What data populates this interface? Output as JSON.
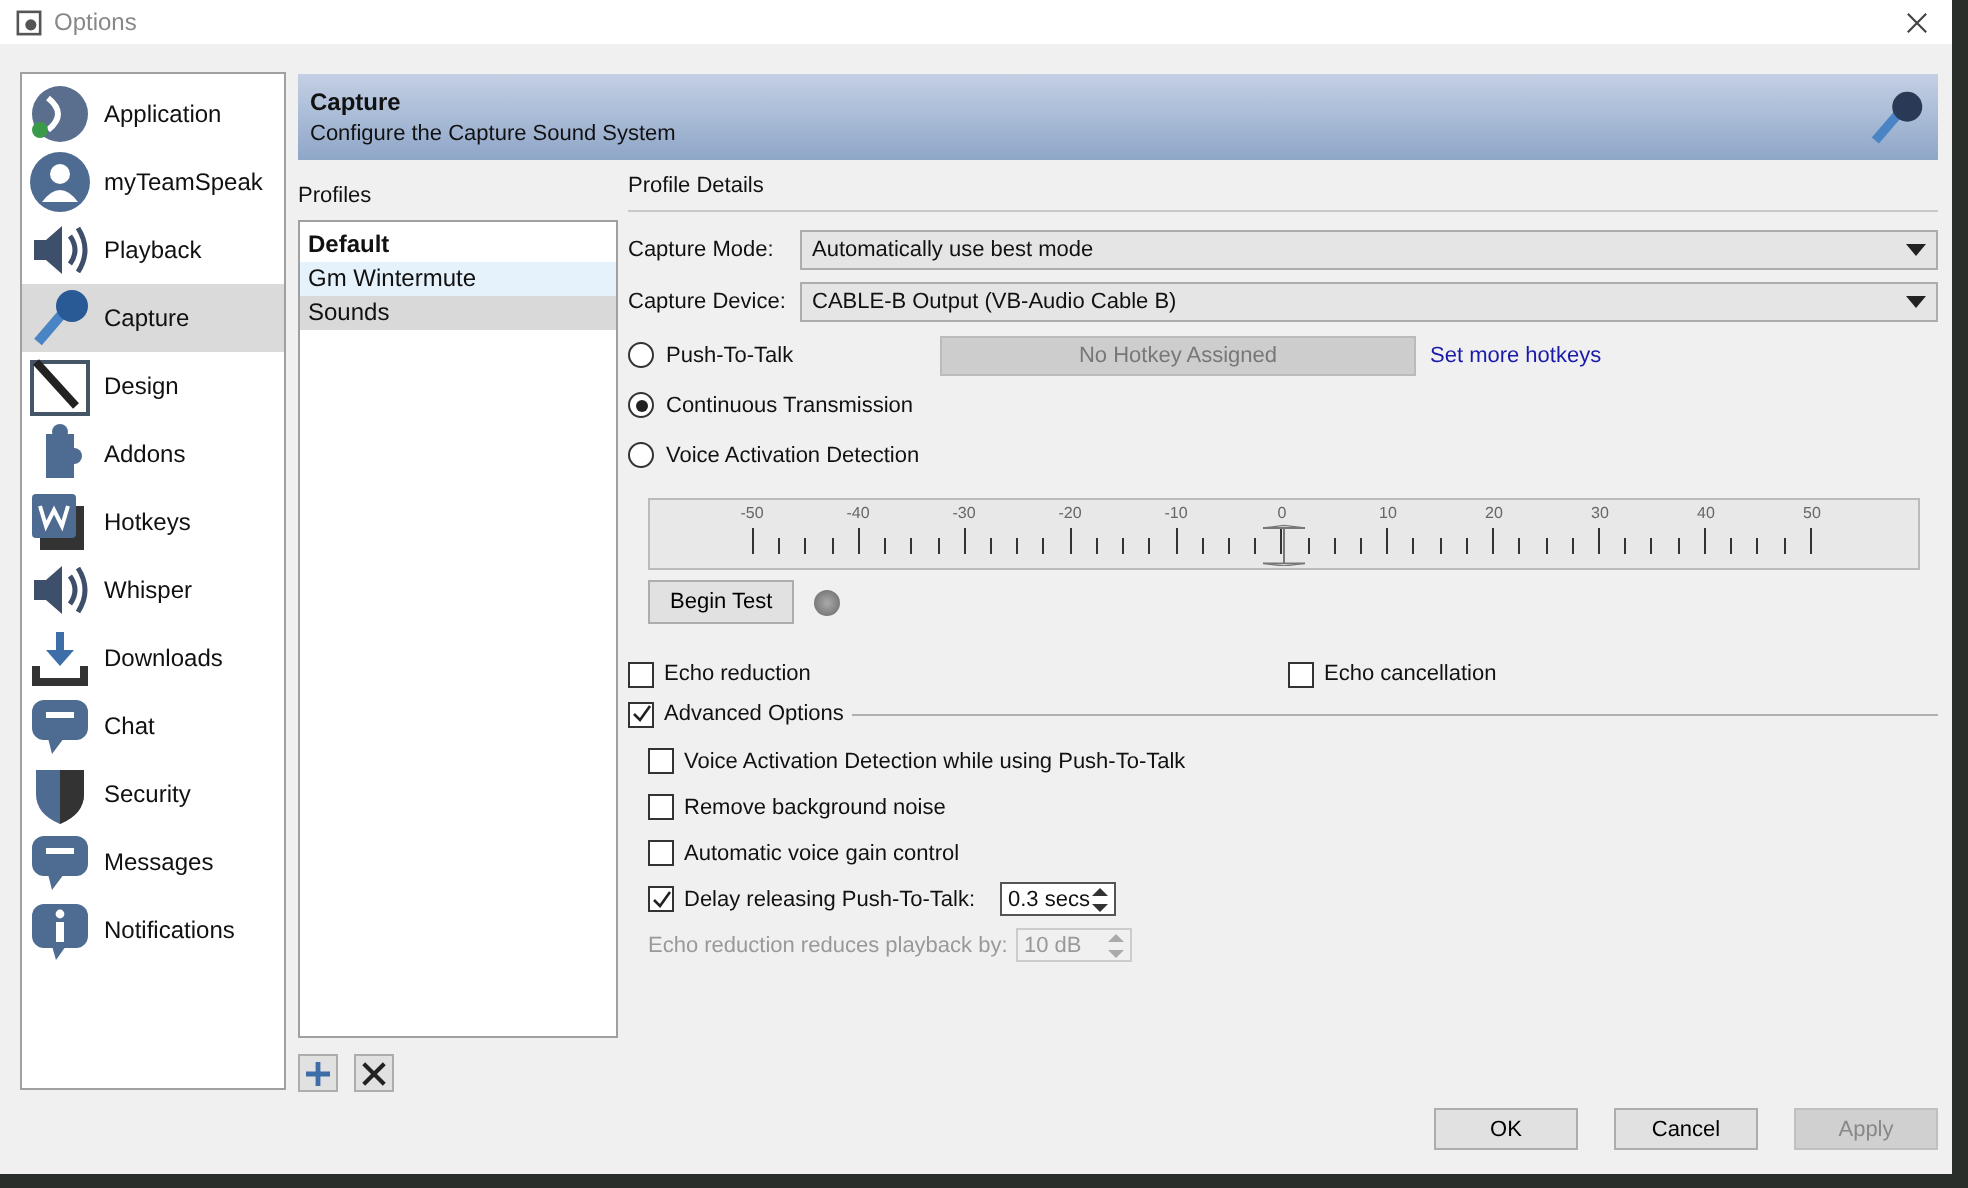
{
  "window": {
    "title": "Options"
  },
  "sidebar": {
    "items": [
      {
        "label": "Application",
        "selected": false
      },
      {
        "label": "myTeamSpeak",
        "selected": false
      },
      {
        "label": "Playback",
        "selected": false
      },
      {
        "label": "Capture",
        "selected": true
      },
      {
        "label": "Design",
        "selected": false
      },
      {
        "label": "Addons",
        "selected": false
      },
      {
        "label": "Hotkeys",
        "selected": false
      },
      {
        "label": "Whisper",
        "selected": false
      },
      {
        "label": "Downloads",
        "selected": false
      },
      {
        "label": "Chat",
        "selected": false
      },
      {
        "label": "Security",
        "selected": false
      },
      {
        "label": "Messages",
        "selected": false
      },
      {
        "label": "Notifications",
        "selected": false
      }
    ]
  },
  "header": {
    "title": "Capture",
    "subtitle": "Configure the Capture Sound System"
  },
  "profiles": {
    "label": "Profiles",
    "items": [
      {
        "label": "Default",
        "default": true,
        "hovered": false,
        "selected": false
      },
      {
        "label": "Gm Wintermute",
        "default": false,
        "hovered": true,
        "selected": false
      },
      {
        "label": "Sounds",
        "default": false,
        "hovered": false,
        "selected": true
      }
    ]
  },
  "details": {
    "heading": "Profile Details",
    "capture_mode": {
      "label": "Capture Mode:",
      "value": "Automatically use best mode"
    },
    "capture_device": {
      "label": "Capture Device:",
      "value": "CABLE-B Output (VB-Audio Cable B)"
    },
    "modes": [
      {
        "label": "Push-To-Talk",
        "selected": false
      },
      {
        "label": "Continuous Transmission",
        "selected": true
      },
      {
        "label": "Voice Activation Detection",
        "selected": false
      }
    ],
    "hotkey": {
      "label": "No Hotkey Assigned",
      "disabled": true
    },
    "hotkey_link": "Set more hotkeys",
    "threshold": {
      "scale": [
        "-50",
        "-40",
        "-30",
        "-20",
        "-10",
        "0",
        "10",
        "20",
        "30",
        "40",
        "50"
      ],
      "level": 0.5
    },
    "begin_test": "Begin Test",
    "echo_reduction": {
      "label": "Echo reduction",
      "checked": false
    },
    "echo_cancellation": {
      "label": "Echo cancellation",
      "checked": false
    },
    "advanced": {
      "label": "Advanced Options",
      "checked": true
    },
    "advanced_options": [
      {
        "kind": "checkbox",
        "label": "Voice Activation Detection while using Push-To-Talk",
        "checked": false
      },
      {
        "kind": "checkbox",
        "label": "Remove background noise",
        "checked": false
      },
      {
        "kind": "checkbox",
        "label": "Automatic voice gain control",
        "checked": false
      },
      {
        "kind": "checkbox-spin",
        "label": "Delay releasing Push-To-Talk:",
        "checked": true,
        "value": "0.3 secs",
        "disabled": false
      },
      {
        "kind": "spin",
        "label": "Echo reduction reduces playback by:",
        "value": "10 dB",
        "disabled": true
      }
    ]
  },
  "buttons": [
    {
      "label": "OK",
      "disabled": false
    },
    {
      "label": "Cancel",
      "disabled": false
    },
    {
      "label": "Apply",
      "disabled": true
    }
  ]
}
